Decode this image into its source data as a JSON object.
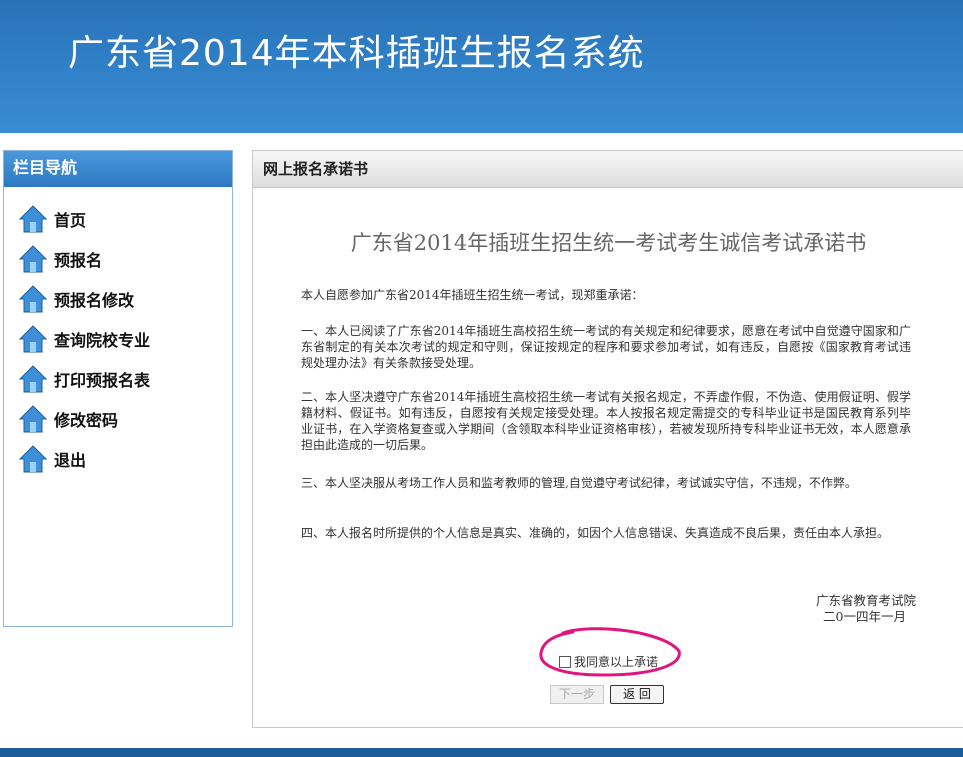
{
  "header": {
    "title": "广东省2014年本科插班生报名系统"
  },
  "sidebar": {
    "title": "栏目导航",
    "items": [
      {
        "label": "首页"
      },
      {
        "label": "预报名"
      },
      {
        "label": "预报名修改"
      },
      {
        "label": "查询院校专业"
      },
      {
        "label": "打印预报名表"
      },
      {
        "label": "修改密码"
      },
      {
        "label": "退出"
      }
    ]
  },
  "content": {
    "header": "网上报名承诺书",
    "title": "广东省2014年插班生招生统一考试考生诚信考试承诺书",
    "intro": "本人自愿参加广东省2014年插班生招生统一考试，现郑重承诺：",
    "paragraphs": [
      "一、本人已阅读了广东省2014年插班生高校招生统一考试的有关规定和纪律要求，愿意在考试中自觉遵守国家和广东省制定的有关本次考试的规定和守则，保证按规定的程序和要求参加考试，如有违反，自愿按《国家教育考试违规处理办法》有关条款接受处理。",
      "二、本人坚决遵守广东省2014年插班生高校招生统一考试有关报名规定，不弄虚作假，不伪造、使用假证明、假学籍材料、假证书。如有违反，自愿按有关规定接受处理。本人按报名规定需提交的专科毕业证书是国民教育系列毕业证书，在入学资格复查或入学期间（含领取本科毕业证资格审核），若被发现所持专科毕业证书无效，本人愿意承担由此造成的一切后果。",
      "三、本人坚决服从考场工作人员和监考教师的管理,自觉遵守考试纪律，考试诚实守信，不违规，不作弊。",
      "四、本人报名时所提供的个人信息是真实、准确的，如因个人信息错误、失真造成不良后果，责任由本人承担。"
    ],
    "signer": "广东省教育考试院",
    "date": "二0一四年一月",
    "agree_label": "我同意以上承诺",
    "next_button": "下一步",
    "back_button": "返 回"
  },
  "colors": {
    "header_blue": "#2f7fc6",
    "annotation_magenta": "#e0157f"
  },
  "icons": {
    "nav_icon": "house-icon"
  }
}
